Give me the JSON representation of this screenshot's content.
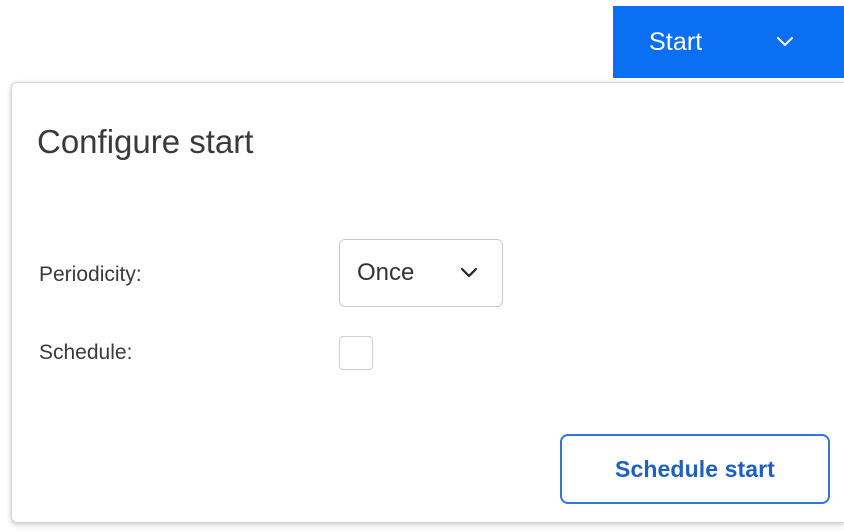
{
  "header": {
    "start_button_label": "Start",
    "start_chevron_icon": "chevron-down-icon",
    "accent_color": "#0a6ff2"
  },
  "panel": {
    "title": "Configure start",
    "fields": {
      "periodicity_label": "Periodicity:",
      "periodicity_value": "Once",
      "periodicity_chevron_icon": "chevron-down-icon",
      "schedule_label": "Schedule:",
      "schedule_checked": false
    },
    "actions": {
      "schedule_start_label": "Schedule start",
      "schedule_start_color": "#1f5fbd"
    }
  }
}
